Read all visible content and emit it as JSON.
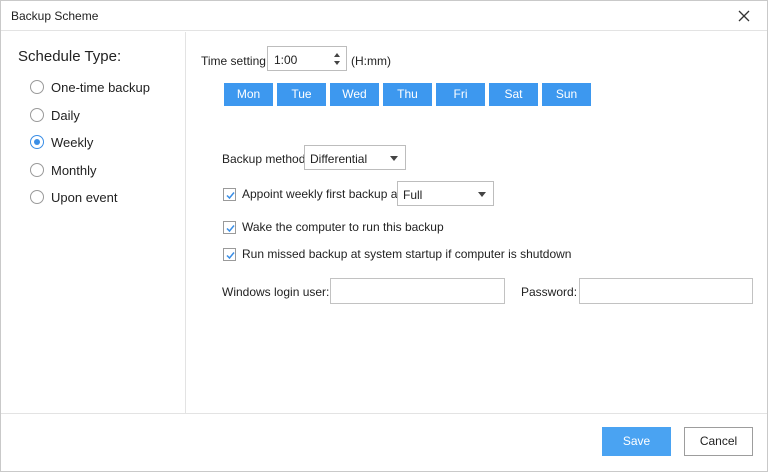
{
  "window": {
    "title": "Backup Scheme",
    "close_icon": "close-icon"
  },
  "schedule": {
    "heading": "Schedule Type:",
    "options": [
      {
        "label": "One-time backup",
        "checked": false
      },
      {
        "label": "Daily",
        "checked": false
      },
      {
        "label": "Weekly",
        "checked": true
      },
      {
        "label": "Monthly",
        "checked": false
      },
      {
        "label": "Upon event",
        "checked": false
      }
    ]
  },
  "time_setting": {
    "label": "Time setting",
    "value": "1:00",
    "format": "(H:mm)"
  },
  "days": [
    "Mon",
    "Tue",
    "Wed",
    "Thu",
    "Fri",
    "Sat",
    "Sun"
  ],
  "backup_method": {
    "label": "Backup method",
    "value": "Differential"
  },
  "options": {
    "appoint_weekly": {
      "label": "Appoint weekly first backup as",
      "checked": true,
      "value": "Full"
    },
    "wake_computer": {
      "label": "Wake the computer to run this backup",
      "checked": true
    },
    "run_missed": {
      "label": "Run missed backup at system startup if computer is shutdown",
      "checked": true
    }
  },
  "credentials": {
    "user_label": "Windows login user:",
    "user_value": "",
    "password_label": "Password:",
    "password_value": ""
  },
  "buttons": {
    "save": "Save",
    "cancel": "Cancel"
  },
  "colors": {
    "accent": "#3d98ef",
    "save_button": "#4aa3f2"
  }
}
